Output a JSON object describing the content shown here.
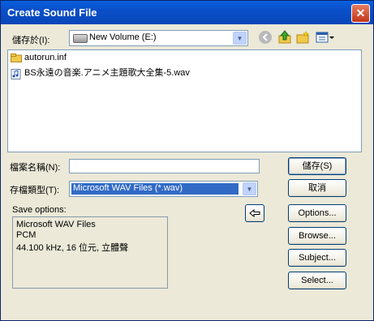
{
  "window": {
    "title": "Create Sound File",
    "close_symbol": "✕"
  },
  "save_in": {
    "label": "儲存於(I):",
    "value": "New Volume (E:)"
  },
  "files": [
    {
      "name": "autorun.inf",
      "icon": "folder-icon"
    },
    {
      "name": "BS永遠の音楽.アニメ主題歌大全集-5.wav",
      "icon": "audio-file-icon"
    }
  ],
  "filename": {
    "label": "檔案名稱(N):",
    "value": ""
  },
  "filetype": {
    "label": "存檔類型(T):",
    "value": "Microsoft WAV Files (*.wav)"
  },
  "buttons": {
    "save": "儲存(S)",
    "cancel": "取消",
    "options": "Options...",
    "browse": "Browse...",
    "subject": "Subject...",
    "select": "Select..."
  },
  "save_options": {
    "label": "Save options:",
    "lines": [
      "Microsoft WAV Files",
      "PCM",
      "44.100 kHz, 16 位元, 立體聲"
    ]
  }
}
